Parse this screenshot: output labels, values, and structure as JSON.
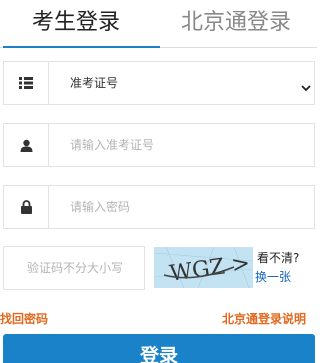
{
  "tabs": {
    "active_label": "考生登录",
    "inactive_label": "北京通登录"
  },
  "form": {
    "id_type_selected": "准考证号",
    "id_number_placeholder": "请输入准考证号",
    "password_placeholder": "请输入密码",
    "captcha_placeholder": "验证码不分大小写",
    "captcha_image_text": "WGZ >",
    "captcha_unclear": "看不清?",
    "captcha_refresh": "换一张"
  },
  "links": {
    "forgot_password": "找回密码",
    "beijingtong_help": "北京通登录说明"
  },
  "login_button": "登录",
  "colors": {
    "accent": "#1a82c8",
    "link_orange": "#e2691e",
    "captcha_bg": "#c3e3f2"
  },
  "icons": {
    "id_type": "list-icon",
    "id_number": "user-icon",
    "password": "lock-icon",
    "select": "chevron-down-icon"
  }
}
